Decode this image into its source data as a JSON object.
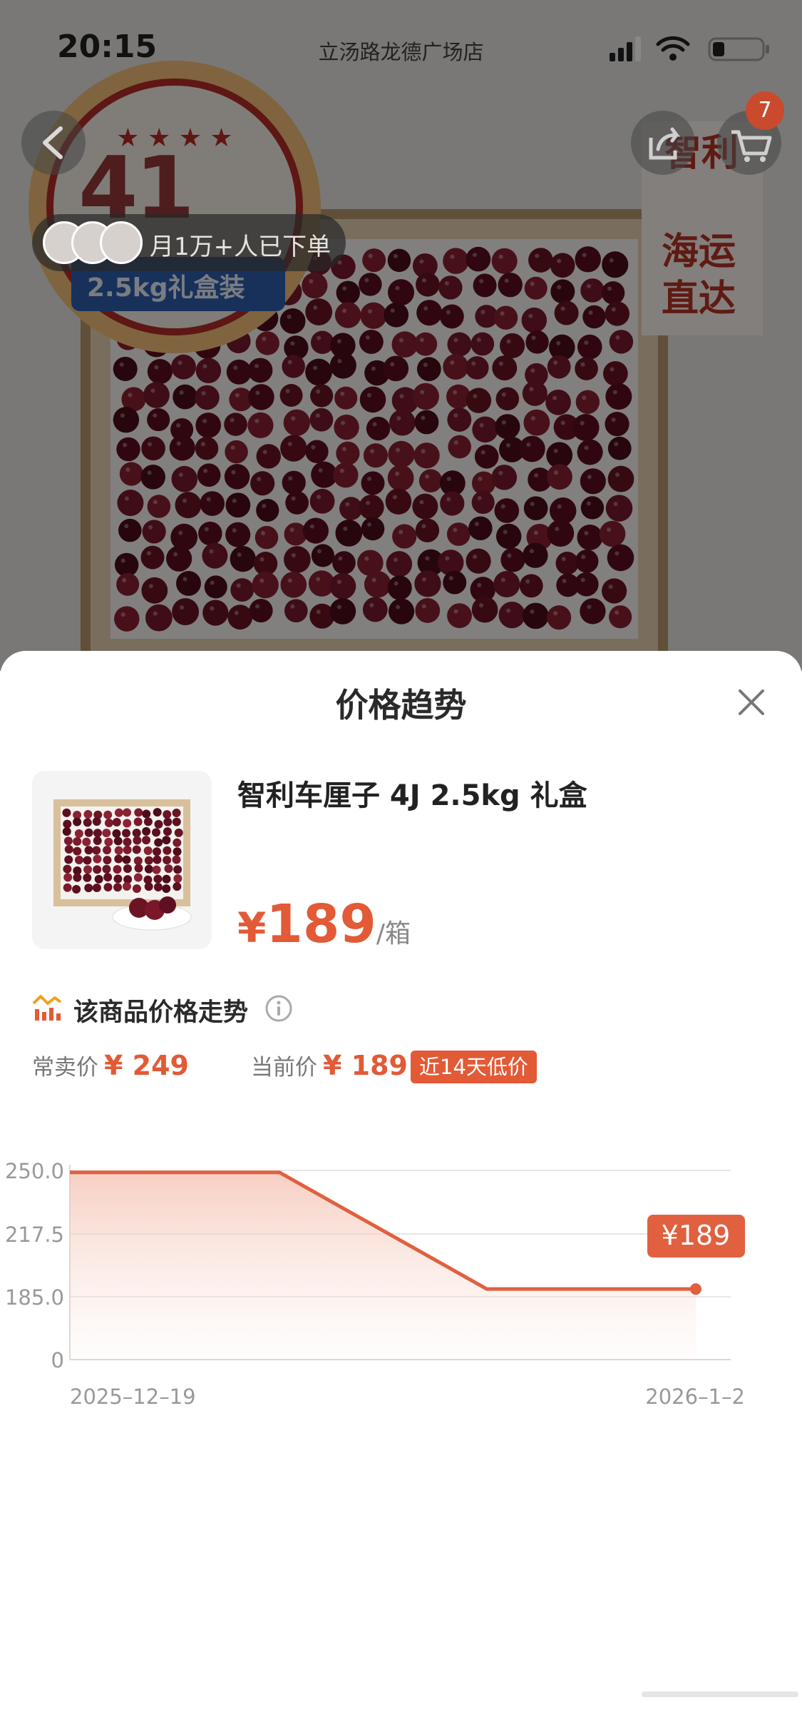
{
  "status_bar": {
    "time": "20:15",
    "store_name": "立汤路龙德广场店"
  },
  "hero": {
    "cart_count": "7",
    "buyers_text": "月1万+人已下单",
    "badge_number": "41",
    "badge_weight": "2.5kg礼盒装",
    "side_text_top": "智利",
    "side_text_mid": "海运",
    "side_text_bottom": "直达"
  },
  "sheet": {
    "title": "价格趋势",
    "product": {
      "name": "智利车厘子 4J 2.5kg 礼盒",
      "price_currency": "¥",
      "price_value": "189",
      "price_unit": "/箱"
    },
    "trend": {
      "title": "该商品价格走势",
      "regular_label": "常卖价",
      "regular_price": "¥ 249",
      "current_label": "当前价",
      "current_price": "¥ 189",
      "low_tag": "近14天低价"
    }
  },
  "colors": {
    "accent": "#e25a36",
    "line": "#e0603f"
  },
  "chart_data": {
    "type": "line",
    "series": [
      {
        "x": [
          "2025-12-19",
          "2025-12-24",
          "2025-12-29",
          "2026-1-2"
        ],
        "values": [
          249,
          249,
          189,
          189
        ]
      }
    ],
    "y_ticks": [
      "250.0",
      "217.5",
      "185.0",
      "0"
    ],
    "x_tick_labels": [
      "2025–12–19",
      "2026–1–2"
    ],
    "last_point_label": "¥189",
    "grid": true,
    "area_fill": true
  }
}
